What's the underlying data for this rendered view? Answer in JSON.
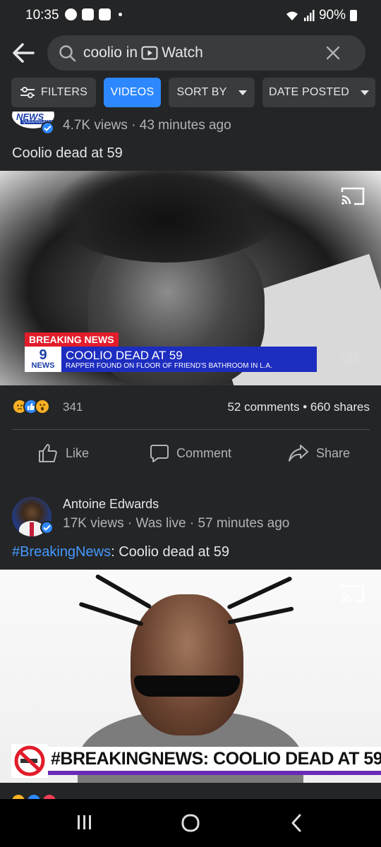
{
  "status_bar": {
    "time": "10:35",
    "battery": "90%",
    "left_icons": [
      "xbox-icon",
      "game-app-icon",
      "youtube-icon",
      "notification-dot"
    ],
    "right_icons": [
      "wifi-icon",
      "signal-icon",
      "battery-icon"
    ]
  },
  "search": {
    "query_prefix": "coolio in",
    "query_scope": "Watch",
    "icons": [
      "back-arrow-icon",
      "search-icon",
      "watch-icon",
      "clear-icon"
    ]
  },
  "filters": {
    "items": [
      {
        "label": "FILTERS",
        "icon": "sliders-icon",
        "active": false
      },
      {
        "label": "VIDEOS",
        "active": true
      },
      {
        "label": "SORT BY",
        "icon": "caret-down-icon",
        "active": false
      },
      {
        "label": "DATE POSTED",
        "icon": "caret-down-icon",
        "active": false
      }
    ]
  },
  "post1": {
    "page_logo_text": "NEWS",
    "page_logo_sub": "QUEENSLAND",
    "meta": "4.7K views · 43 minutes ago",
    "title": "Coolio dead at 59",
    "video": {
      "breaking_label": "BREAKING NEWS",
      "channel_logo_top": "9",
      "channel_logo_bottom": "NEWS",
      "headline": "COOLIO DEAD AT 59",
      "subheadline": "RAPPER FOUND ON FLOOR OF FRIEND'S BATHROOM IN L.A."
    },
    "reactions": {
      "count": "341",
      "types": [
        "sad",
        "like",
        "wow"
      ]
    },
    "engagement": "52 comments • 660 shares",
    "actions": [
      {
        "label": "Like",
        "icon": "thumbs-up-icon"
      },
      {
        "label": "Comment",
        "icon": "comment-icon"
      },
      {
        "label": "Share",
        "icon": "share-icon"
      }
    ]
  },
  "post2": {
    "author": "Antoine Edwards",
    "meta": "17K views · Was live · 57 minutes ago",
    "hashtag": "#BreakingNews",
    "title_rest": ": Coolio dead at 59",
    "banner_text": "#BREAKINGNEWS: COOLIO DEAD AT 59"
  },
  "colors": {
    "background": "#242526",
    "surface": "#3a3b3c",
    "accent": "#2d88ff",
    "text_primary": "#e4e6eb",
    "text_secondary": "#b0b3b8",
    "hashtag": "#4599ff",
    "breaking_red": "#e21c2a",
    "news_blue": "#1d2dbf"
  },
  "nav": {
    "buttons": [
      "recents-icon",
      "home-icon",
      "back-icon"
    ]
  }
}
